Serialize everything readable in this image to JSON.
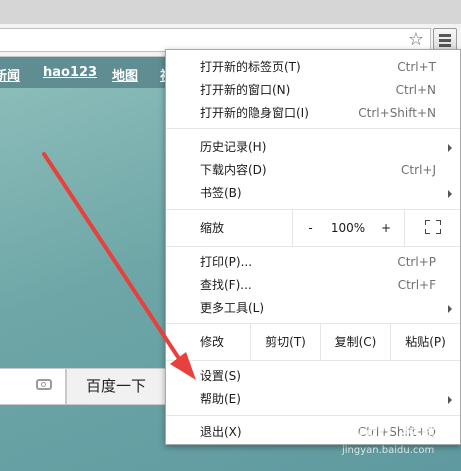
{
  "nav": {
    "items": [
      "新闻",
      "hao123",
      "地图",
      "视"
    ]
  },
  "search": {
    "button_label": "百度一下"
  },
  "menu": {
    "group1": [
      {
        "label": "打开新的标签页(T)",
        "shortcut": "Ctrl+T"
      },
      {
        "label": "打开新的窗口(N)",
        "shortcut": "Ctrl+N"
      },
      {
        "label": "打开新的隐身窗口(I)",
        "shortcut": "Ctrl+Shift+N"
      }
    ],
    "group2": [
      {
        "label": "历史记录(H)",
        "shortcut": ""
      },
      {
        "label": "下载内容(D)",
        "shortcut": "Ctrl+J"
      },
      {
        "label": "书签(B)",
        "shortcut": ""
      }
    ],
    "zoom": {
      "label": "缩放",
      "minus": "-",
      "value": "100%",
      "plus": "+"
    },
    "group3": [
      {
        "label": "打印(P)...",
        "shortcut": "Ctrl+P"
      },
      {
        "label": "查找(F)...",
        "shortcut": "Ctrl+F"
      },
      {
        "label": "更多工具(L)",
        "shortcut": ""
      }
    ],
    "edit": {
      "label": "修改",
      "cut": "剪切(T)",
      "copy": "复制(C)",
      "paste": "粘贴(P)"
    },
    "group4": [
      {
        "label": "设置(S)",
        "shortcut": ""
      },
      {
        "label": "帮助(E)",
        "shortcut": ""
      }
    ],
    "exit": {
      "label": "退出(X)",
      "shortcut": "Ctrl+Shift+Q"
    }
  },
  "watermark": {
    "main": "Baidu 经验",
    "sub": "jingyan.baidu.com"
  },
  "colors": {
    "annotation_arrow": "#e8403a",
    "page_bg": "#6fa3a3"
  }
}
